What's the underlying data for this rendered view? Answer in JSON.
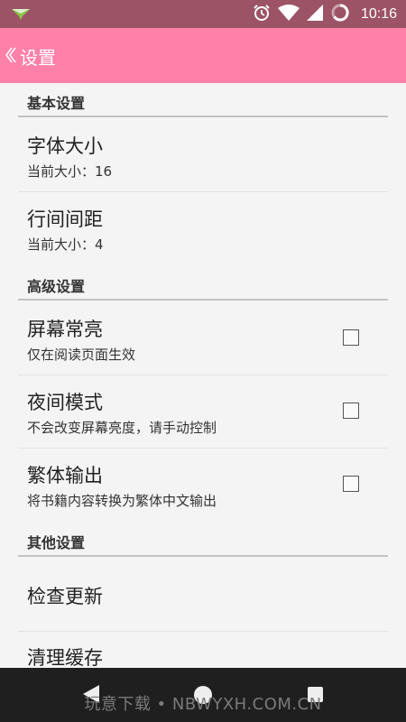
{
  "status_bar": {
    "time": "10:16",
    "icons": [
      "notification-icon",
      "alarm-icon",
      "wifi-icon",
      "cellular-signal-icon",
      "battery-icon"
    ]
  },
  "app_bar": {
    "back_glyph": "《",
    "title": "设置"
  },
  "sections": {
    "basic": {
      "header": "基本设置",
      "font_size": {
        "title": "字体大小",
        "summary": "当前大小：16"
      },
      "line_spacing": {
        "title": "行间间距",
        "summary": "当前大小：4"
      }
    },
    "advanced": {
      "header": "高级设置",
      "screen_on": {
        "title": "屏幕常亮",
        "summary": "仅在阅读页面生效",
        "checked": false
      },
      "night_mode": {
        "title": "夜间模式",
        "summary": "不会改变屏幕亮度，请手动控制",
        "checked": false
      },
      "traditional": {
        "title": "繁体输出",
        "summary": "将书籍内容转换为繁体中文输出",
        "checked": false
      }
    },
    "other": {
      "header": "其他设置",
      "check_update": {
        "title": "检查更新"
      },
      "clear_cache": {
        "title": "清理缓存"
      }
    }
  },
  "watermark": "玩意下载 • NBWYXH.COM.CN",
  "colors": {
    "status_bar": "#9c5366",
    "app_bar": "#ff80a8",
    "background": "#f4f4f4",
    "nav_bar": "#1f1f1f"
  }
}
